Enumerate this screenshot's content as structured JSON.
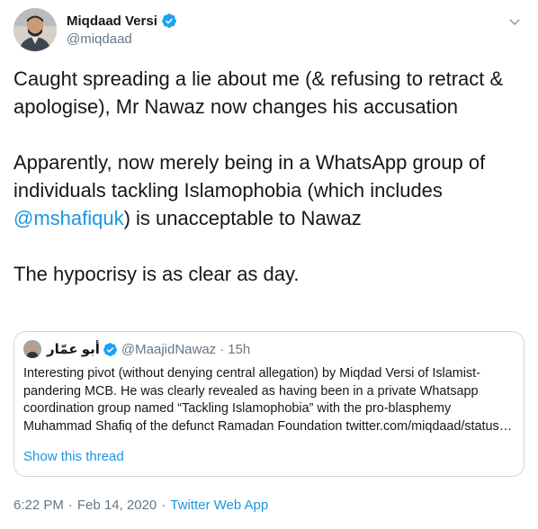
{
  "author": {
    "display_name": "Miqdaad Versi",
    "handle": "@miqdaad",
    "verified": true
  },
  "tweet": {
    "paragraph_1": "Caught spreading a lie about me (& refusing to retract & apologise), Mr Nawaz now changes his accusation",
    "paragraph_2_before": "Apparently, now merely being in a WhatsApp group of individuals tackling Islamophobia (which includes ",
    "paragraph_2_mention": "@mshafiquk",
    "paragraph_2_after": ") is unacceptable to Nawaz",
    "paragraph_3": "The hypocrisy is as clear as day."
  },
  "quoted_tweet": {
    "display_name": "أبو عمّار",
    "handle": "@MaajidNawaz",
    "separator": "·",
    "time": "15h",
    "text": "Interesting pivot (without denying central allegation) by Miqdad Versi of Islamist-pandering MCB. He was clearly revealed as having been in a private Whatsapp coordination group named “Tackling Islamophobia” with the pro-blasphemy Muhammad Shafiq of the defunct Ramadan Foundation twitter.com/miqdaad/status…",
    "show_thread": "Show this thread"
  },
  "meta": {
    "time": "6:22 PM",
    "sep1": "·",
    "date": "Feb 14, 2020",
    "sep2": "·",
    "source": "Twitter Web App"
  },
  "colors": {
    "link": "#1b95e0",
    "muted": "#657786",
    "verified": "#1da1f2",
    "border": "#ccd6dd"
  },
  "icons": {
    "verified": "verified-badge-icon",
    "caret": "chevron-down-icon"
  }
}
